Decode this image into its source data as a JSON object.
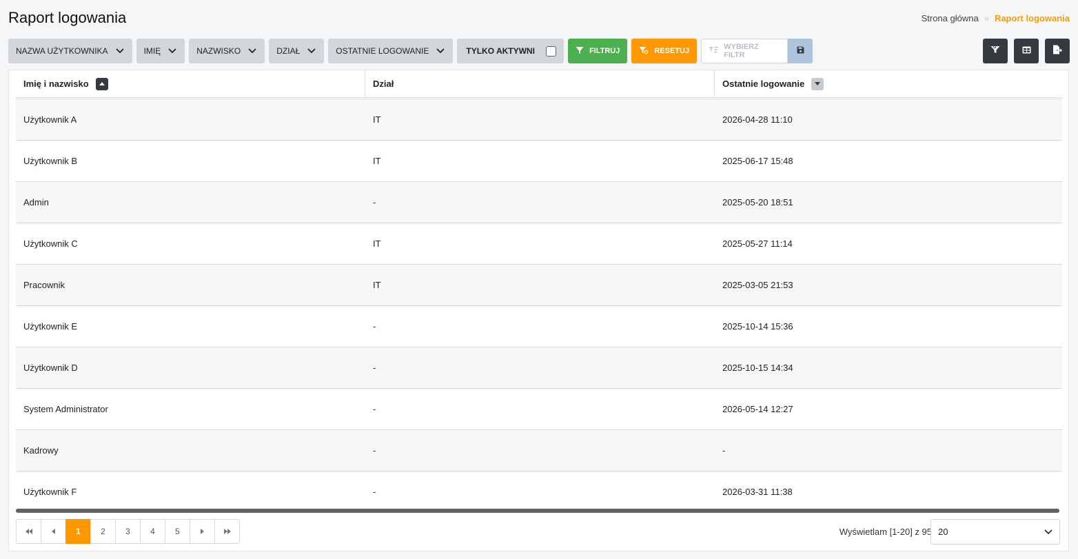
{
  "page": {
    "title": "Raport logowania"
  },
  "breadcrumb": {
    "home": "Strona główna",
    "separator": "»",
    "current": "Raport logowania"
  },
  "filters": {
    "dropdowns": [
      "NAZWA UŻYTKOWNIKA",
      "IMIĘ",
      "NAZWISKO",
      "DZIAŁ",
      "OSTATNIE LOGOWANIE"
    ],
    "only_active_label": "TYLKO AKTYWNI",
    "only_active_checked": false,
    "filter_button": "FILTRUJ",
    "reset_button": "RESETUJ",
    "select_filter_placeholder": "WYBIERZ FILTR"
  },
  "toolbar_icons": [
    "filter-icon",
    "save-icon",
    "funnel-icon",
    "table-icon",
    "export-icon"
  ],
  "colors": {
    "accent": "#ff9800",
    "filter_green": "#4caf50",
    "dark_button": "#343a40"
  },
  "table": {
    "columns": [
      "Imię i nazwisko",
      "Dział",
      "Ostatnie logowanie"
    ],
    "sort": {
      "column": "Imię i nazwisko",
      "direction": "asc"
    },
    "rows": [
      {
        "name": "Użytkownik A",
        "dept": "IT",
        "last_login": "2026-04-28 11:10"
      },
      {
        "name": "Użytkownik B",
        "dept": "IT",
        "last_login": "2025-06-17 15:48"
      },
      {
        "name": "Admin",
        "dept": "-",
        "last_login": "2025-05-20 18:51"
      },
      {
        "name": "Użytkownik C",
        "dept": "IT",
        "last_login": "2025-05-27 11:14"
      },
      {
        "name": "Pracownik",
        "dept": "IT",
        "last_login": "2025-03-05 21:53"
      },
      {
        "name": "Użytkownik E",
        "dept": "-",
        "last_login": "2025-10-14 15:36"
      },
      {
        "name": "Użytkownik D",
        "dept": "-",
        "last_login": "2025-10-15 14:34"
      },
      {
        "name": "System Administrator",
        "dept": "-",
        "last_login": "2026-05-14 12:27"
      },
      {
        "name": "Kadrowy",
        "dept": "-",
        "last_login": "-"
      },
      {
        "name": "Użytkownik F",
        "dept": "-",
        "last_login": "2026-03-31 11:38"
      }
    ]
  },
  "pagination": {
    "pages": [
      "1",
      "2",
      "3",
      "4",
      "5"
    ],
    "current_page": "1",
    "info": "Wyświetlam [1-20] z 95",
    "per_page": "20"
  }
}
